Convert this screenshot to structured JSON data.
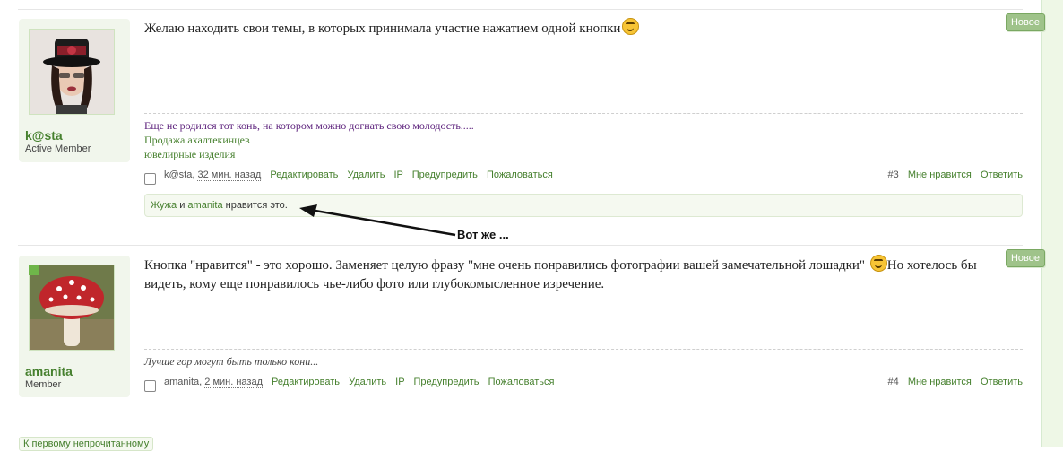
{
  "badges": {
    "new_label": "Новое"
  },
  "posts": [
    {
      "author": {
        "name": "k@sta",
        "title": "Active Member"
      },
      "message": "Желаю находить свои темы, в которых принимала участие нажатием одной кнопки",
      "signature": [
        "Еще не родился тот конь, на котором можно догнать свою молодость.....",
        "Продажа ахалтекинцев",
        "ювелирные изделия"
      ],
      "meta": {
        "author_short": "k@sta",
        "date": "32 мин. назад"
      },
      "number": "#3",
      "likes": {
        "user1": "Жужа",
        "joiner": "и",
        "user2": "amanita",
        "suffix": "нравится это."
      }
    },
    {
      "author": {
        "name": "amanita",
        "title": "Member"
      },
      "message": "Кнопка \"нравится\" - это хорошо. Заменяет целую фразу \"мне очень понравились фотографии вашей замечательной лошадки\"",
      "message_cont": "Но хотелось бы видеть, кому еще понравилось чье-либо фото или глубокомысленное изречение.",
      "signature": [
        "Лучше гор могут быть только кони..."
      ],
      "meta": {
        "author_short": "amanita",
        "date": "2 мин. назад"
      },
      "number": "#4"
    }
  ],
  "actions": {
    "edit": "Редактировать",
    "delete": "Удалить",
    "ip": "IP",
    "warn": "Предупредить",
    "report": "Пожаловаться",
    "like": "Мне нравится",
    "reply": "Ответить"
  },
  "annotation": "Вот же ...",
  "footer": {
    "first_unread": "К первому непрочитанному"
  },
  "colors": {
    "link": "#46802e",
    "badge": "#9fc38a",
    "signature_purple": "#5a1e7a"
  }
}
